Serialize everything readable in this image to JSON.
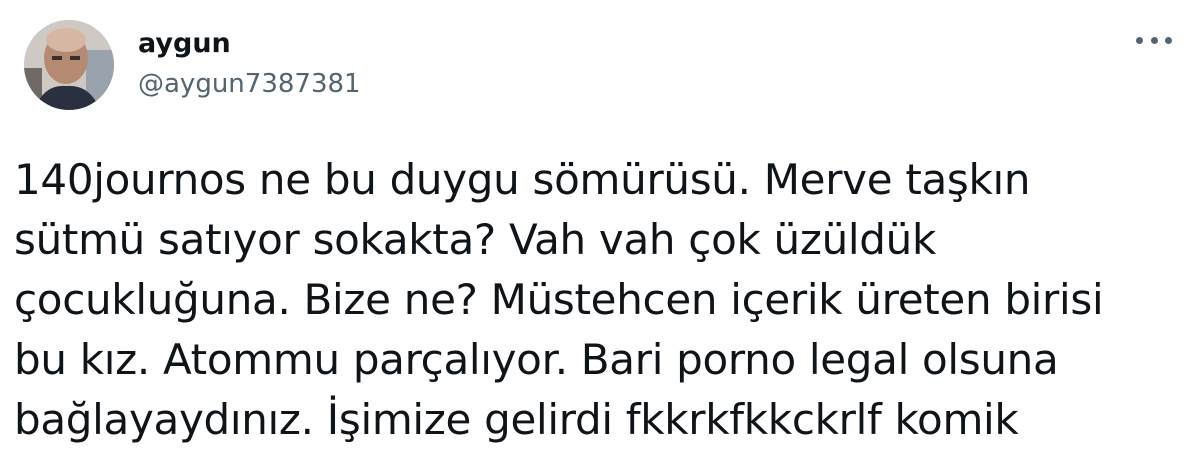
{
  "author": {
    "name": "aygun",
    "handle": "@aygun7387381"
  },
  "avatar_icon": "user-avatar-photo",
  "more_icon": "more-horizontal-icon",
  "tweet": {
    "lines": [
      "140journos ne bu duygu sömürüsü. Merve taşkın",
      "sütmü satıyor sokakta? Vah vah çok üzüldük",
      "çocukluğuna. Bize ne? Müstehcen içerik üreten birisi",
      "bu kız. Atommu parçalıyor. Bari porno legal olsuna",
      "bağlayaydınız. İşimize gelirdi fkkrkfkkckrlf komik"
    ]
  },
  "colors": {
    "text_primary": "#0f1419",
    "text_secondary": "#536471",
    "background": "#ffffff"
  }
}
